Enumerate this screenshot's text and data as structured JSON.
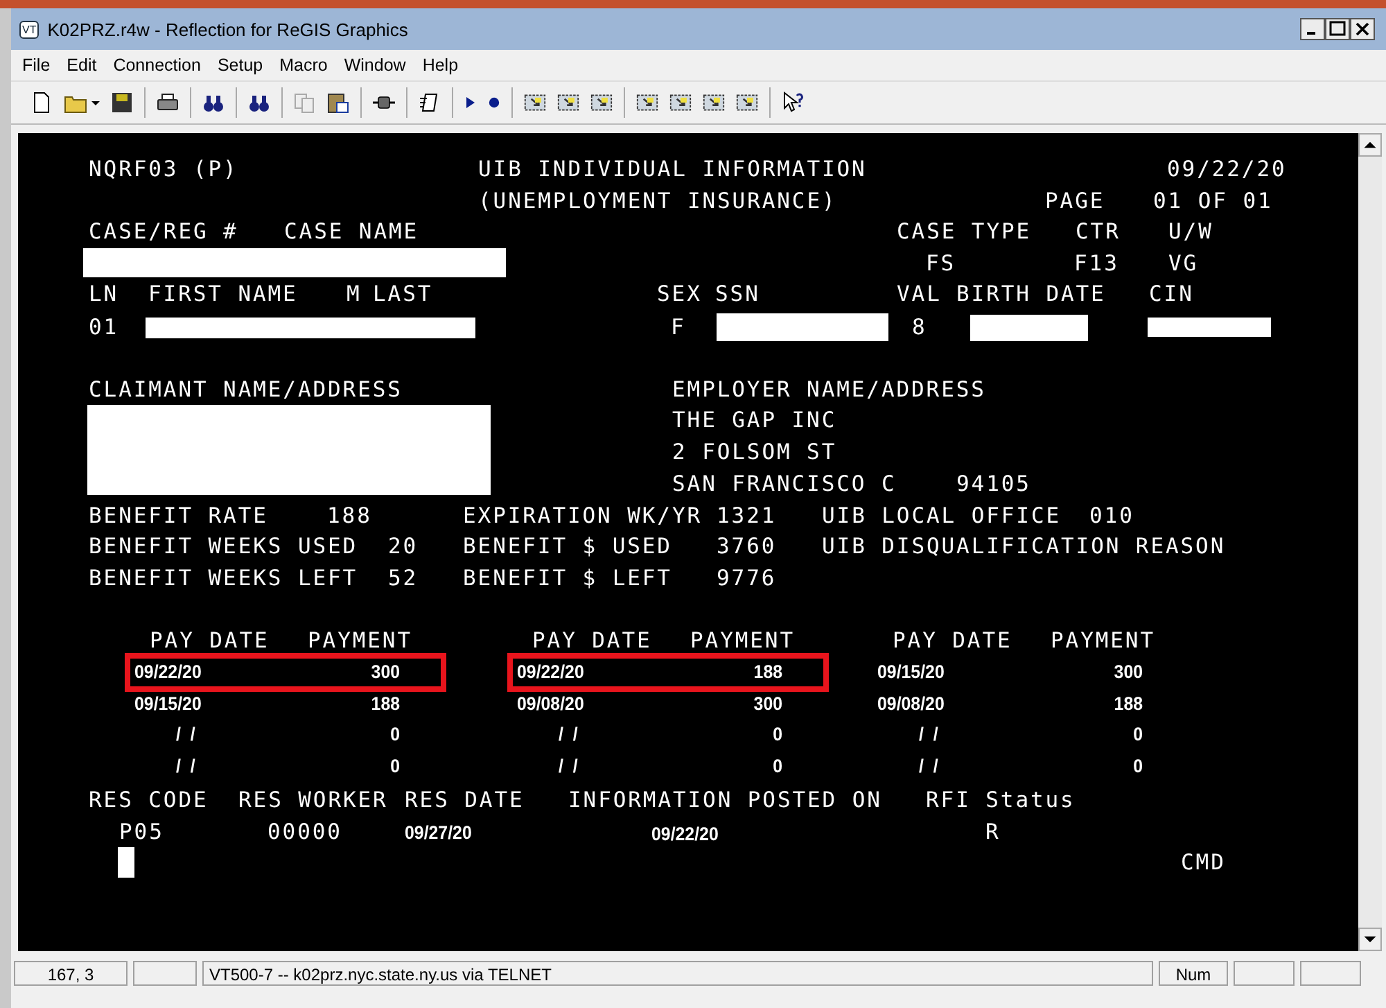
{
  "window": {
    "icon_text": "VT",
    "title": "K02PRZ.r4w - Reflection for ReGIS Graphics"
  },
  "menu": [
    "File",
    "Edit",
    "Connection",
    "Setup",
    "Macro",
    "Window",
    "Help"
  ],
  "terminal": {
    "texts": [
      {
        "text": "NQRF03 (P)"
      },
      {
        "text": "UIB INDIVIDUAL INFORMATION"
      },
      {
        "text": "09/22/20"
      },
      {
        "text": "(UNEMPLOYMENT INSURANCE)"
      },
      {
        "text": "PAGE"
      },
      {
        "text": "01 OF 01"
      },
      {
        "text": "CASE/REG #"
      },
      {
        "text": "CASE NAME"
      },
      {
        "text": "CASE TYPE"
      },
      {
        "text": "CTR"
      },
      {
        "text": "U/W"
      },
      {
        "text": "FS"
      },
      {
        "text": "F13"
      },
      {
        "text": "VG"
      },
      {
        "text": "LN"
      },
      {
        "text": "FIRST NAME"
      },
      {
        "text": "M"
      },
      {
        "text": "LAST"
      },
      {
        "text": "SEX"
      },
      {
        "text": "SSN"
      },
      {
        "text": "VAL"
      },
      {
        "text": "BIRTH DATE"
      },
      {
        "text": "CIN"
      },
      {
        "text": "01"
      },
      {
        "text": "F"
      },
      {
        "text": "8"
      },
      {
        "text": "CLAIMANT NAME/ADDRESS"
      },
      {
        "text": "EMPLOYER NAME/ADDRESS"
      },
      {
        "text": "THE GAP INC"
      },
      {
        "text": "2 FOLSOM ST"
      },
      {
        "text": "SAN FRANCISCO C"
      },
      {
        "text": "94105"
      },
      {
        "text": "BENEFIT RATE"
      },
      {
        "text": "188"
      },
      {
        "text": "EXPIRATION WK/YR"
      },
      {
        "text": "1321"
      },
      {
        "text": "UIB LOCAL OFFICE"
      },
      {
        "text": "010"
      },
      {
        "text": "BENEFIT WEEKS USED"
      },
      {
        "text": "20"
      },
      {
        "text": "BENEFIT $ USED"
      },
      {
        "text": "3760"
      },
      {
        "text": "UIB DISQUALIFICATION REASON"
      },
      {
        "text": "BENEFIT WEEKS LEFT"
      },
      {
        "text": "52"
      },
      {
        "text": "BENEFIT $ LEFT"
      },
      {
        "text": "9776"
      },
      {
        "text": "RES CODE"
      },
      {
        "text": "RES WORKER"
      },
      {
        "text": "RES DATE"
      },
      {
        "text": "INFORMATION POSTED ON"
      },
      {
        "text": "RFI Status"
      },
      {
        "text": "P05"
      },
      {
        "text": "00000"
      },
      {
        "text": "09/27/20",
        "kind": "small"
      },
      {
        "text": "09/22/20",
        "kind": "small"
      },
      {
        "text": "R"
      },
      {
        "text": "CMD"
      }
    ],
    "payment_columns": [
      {
        "headers": [
          "PAY DATE",
          "PAYMENT"
        ],
        "entries": [
          {
            "pay_date": "09/22/20",
            "payment": "300",
            "highlighted": true
          },
          {
            "pay_date": "09/15/20",
            "payment": "188",
            "highlighted": false
          },
          {
            "pay_date": "/  /",
            "payment": "0",
            "highlighted": false
          },
          {
            "pay_date": "/  /",
            "payment": "0",
            "highlighted": false
          }
        ]
      },
      {
        "headers": [
          "PAY DATE",
          "PAYMENT"
        ],
        "entries": [
          {
            "pay_date": "09/22/20",
            "payment": "188",
            "highlighted": true
          },
          {
            "pay_date": "09/08/20",
            "payment": "300",
            "highlighted": false
          },
          {
            "pay_date": "/  /",
            "payment": "0",
            "highlighted": false
          },
          {
            "pay_date": "/  /",
            "payment": "0",
            "highlighted": false
          }
        ]
      },
      {
        "headers": [
          "PAY DATE",
          "PAYMENT"
        ],
        "entries": [
          {
            "pay_date": "09/15/20",
            "payment": "300",
            "highlighted": false
          },
          {
            "pay_date": "09/08/20",
            "payment": "188",
            "highlighted": false
          },
          {
            "pay_date": "/  /",
            "payment": "0",
            "highlighted": false
          },
          {
            "pay_date": "/  /",
            "payment": "0",
            "highlighted": false
          }
        ]
      }
    ]
  },
  "status_bar": [
    "167, 3",
    "VT500-7 -- k02prz.nyc.state.ny.us via TELNET",
    "Num"
  ]
}
